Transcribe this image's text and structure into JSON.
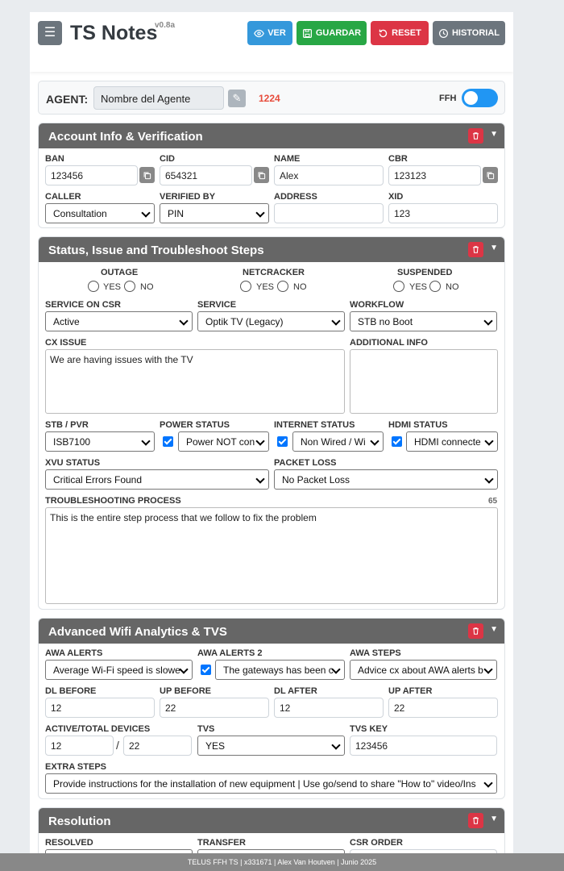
{
  "header": {
    "title": "TS Notes",
    "version": "v0.8a",
    "buttons": {
      "ver": "VER",
      "guardar": "GUARDAR",
      "reset": "RESET",
      "historial": "HISTORIAL"
    }
  },
  "agent": {
    "label": "AGENT:",
    "name_placeholder": "Nombre del Agente",
    "code": "1224",
    "ffh_label": "FFH",
    "ffh_on": true
  },
  "account": {
    "title": "Account Info & Verification",
    "ban": {
      "label": "BAN",
      "value": "123456"
    },
    "cid": {
      "label": "CID",
      "value": "654321"
    },
    "name": {
      "label": "NAME",
      "value": "Alex"
    },
    "cbr": {
      "label": "CBR",
      "value": "123123"
    },
    "caller": {
      "label": "CALLER",
      "value": "Consultation"
    },
    "verified": {
      "label": "VERIFIED BY",
      "value": "PIN"
    },
    "address": {
      "label": "ADDRESS",
      "value": ""
    },
    "xid": {
      "label": "XID",
      "value": "123"
    }
  },
  "status": {
    "title": "Status, Issue and Troubleshoot Steps",
    "outage": "OUTAGE",
    "netcracker": "NETCRACKER",
    "suspended": "SUSPENDED",
    "yes": "YES",
    "no": "NO",
    "service_csr": {
      "label": "SERVICE ON CSR",
      "value": "Active"
    },
    "service": {
      "label": "SERVICE",
      "value": "Optik TV (Legacy)"
    },
    "workflow": {
      "label": "WORKFLOW",
      "value": "STB no Boot"
    },
    "cx_issue": {
      "label": "CX ISSUE",
      "value": "We are having issues with the TV"
    },
    "additional": {
      "label": "ADDITIONAL INFO",
      "value": ""
    },
    "stb": {
      "label": "STB / PVR",
      "value": "ISB7100"
    },
    "power": {
      "label": "POWER STATUS",
      "value": "Power NOT con"
    },
    "internet": {
      "label": "INTERNET STATUS",
      "value": "Non Wired / Wi"
    },
    "hdmi": {
      "label": "HDMI STATUS",
      "value": "HDMI connecte"
    },
    "xvu": {
      "label": "XVU STATUS",
      "value": "Critical Errors Found"
    },
    "packet": {
      "label": "PACKET LOSS",
      "value": "No Packet Loss"
    },
    "process": {
      "label": "TROUBLESHOOTING PROCESS",
      "count": "65",
      "value": "This is the entire step process that we follow to fix the problem"
    }
  },
  "wifi": {
    "title": "Advanced Wifi Analytics & TVS",
    "alerts": {
      "label": "AWA ALERTS",
      "value": "Average Wi-Fi speed is slowe"
    },
    "alerts2": {
      "label": "AWA ALERTS 2",
      "value": "The gateways has been c"
    },
    "steps": {
      "label": "AWA STEPS",
      "value": "Advice cx about AWA alerts b"
    },
    "dl_before": {
      "label": "DL BEFORE",
      "value": "12"
    },
    "up_before": {
      "label": "UP BEFORE",
      "value": "22"
    },
    "dl_after": {
      "label": "DL AFTER",
      "value": "12"
    },
    "up_after": {
      "label": "UP AFTER",
      "value": "22"
    },
    "devices": {
      "label": "ACTIVE/TOTAL DEVICES",
      "active": "12",
      "sep": "/",
      "total": "22"
    },
    "tvs": {
      "label": "TVS",
      "value": "YES"
    },
    "tvs_key": {
      "label": "TVS KEY",
      "value": "123456"
    },
    "extra": {
      "label": "EXTRA STEPS",
      "value": "Provide instructions for the installation of new equipment | Use go/send to share \"How to\" video/Ins"
    }
  },
  "resolution": {
    "title": "Resolution",
    "resolved": "RESOLVED",
    "transfer": "TRANSFER",
    "csr_order": "CSR ORDER"
  },
  "footer": "TELUS FFH TS | x331671 | Alex Van Houtven | Junio 2025",
  "colors": {
    "ver": "#3498db",
    "guardar": "#28a745",
    "reset": "#dc3545",
    "historial": "#6c757d",
    "section_header": "#666666",
    "code": "#e74c3c",
    "toggle": "#2196f3"
  }
}
